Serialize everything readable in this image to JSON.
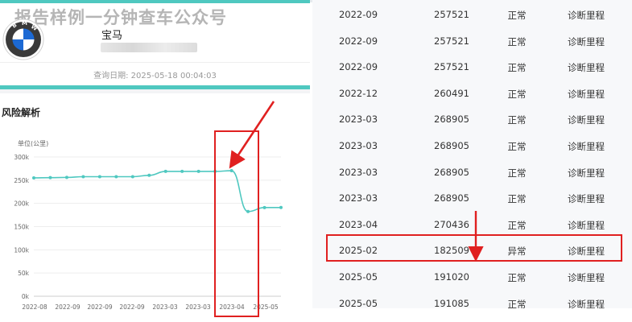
{
  "watermark": "报告样例一分钟查车公众号",
  "vehicle": {
    "brand": "宝马",
    "query_date": "查询日期: 2025-05-18 00:04:03"
  },
  "risk_section": {
    "title": "风险解析"
  },
  "chart_data": {
    "type": "line",
    "unit_label": "单位(公里)",
    "y_ticks": [
      "0k",
      "50k",
      "100k",
      "150k",
      "200k",
      "250k",
      "300k"
    ],
    "ylim": [
      0,
      300000
    ],
    "x_tick_labels": [
      "2022-08",
      "2022-09",
      "2022-09",
      "2022-09",
      "2023-03",
      "2023-03",
      "2023-04",
      "2025-05"
    ],
    "values": [
      255000,
      255500,
      256000,
      257521,
      257521,
      257521,
      257521,
      260491,
      268905,
      268905,
      268905,
      268905,
      270436,
      182509,
      191020,
      191085
    ],
    "grid": true,
    "line_color": "#4fc8c0"
  },
  "records": [
    {
      "date": "2022-09",
      "mileage": "257521",
      "status": "正常",
      "source": "诊断里程"
    },
    {
      "date": "2022-09",
      "mileage": "257521",
      "status": "正常",
      "source": "诊断里程"
    },
    {
      "date": "2022-09",
      "mileage": "257521",
      "status": "正常",
      "source": "诊断里程"
    },
    {
      "date": "2022-12",
      "mileage": "260491",
      "status": "正常",
      "source": "诊断里程"
    },
    {
      "date": "2023-03",
      "mileage": "268905",
      "status": "正常",
      "source": "诊断里程"
    },
    {
      "date": "2023-03",
      "mileage": "268905",
      "status": "正常",
      "source": "诊断里程"
    },
    {
      "date": "2023-03",
      "mileage": "268905",
      "status": "正常",
      "source": "诊断里程"
    },
    {
      "date": "2023-03",
      "mileage": "268905",
      "status": "正常",
      "source": "诊断里程"
    },
    {
      "date": "2023-04",
      "mileage": "270436",
      "status": "正常",
      "source": "诊断里程"
    },
    {
      "date": "2025-02",
      "mileage": "182509",
      "status": "异常",
      "source": "诊断里程"
    },
    {
      "date": "2025-05",
      "mileage": "191020",
      "status": "正常",
      "source": "诊断里程"
    },
    {
      "date": "2025-05",
      "mileage": "191085",
      "status": "正常",
      "source": "诊断里程"
    }
  ],
  "colors": {
    "accent": "#4fc8c0",
    "highlight": "#e02020",
    "logo_blue": "#1c69d4"
  }
}
